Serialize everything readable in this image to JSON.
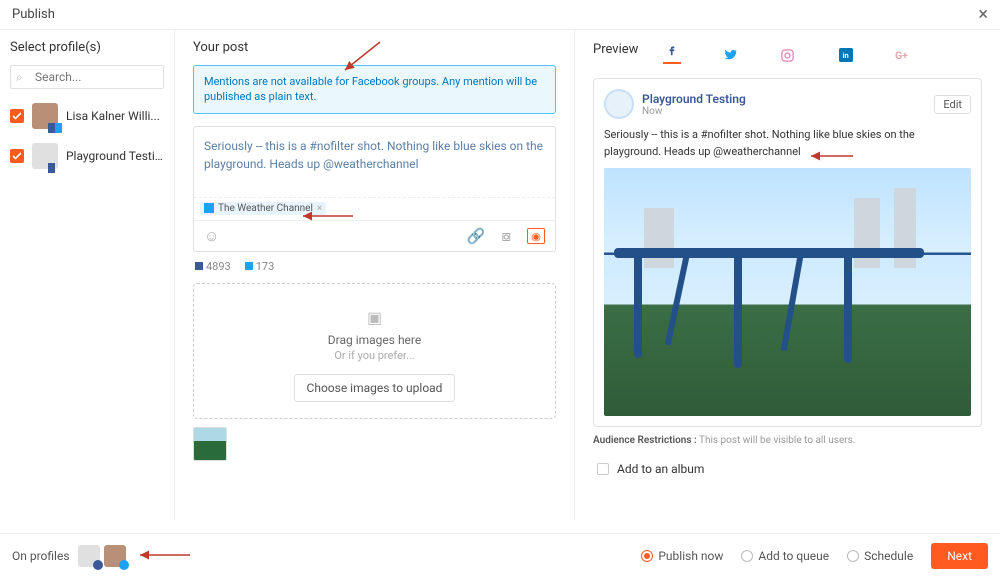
{
  "window": {
    "title": "Publish"
  },
  "left": {
    "heading": "Select profile(s)",
    "search_placeholder": "Search...",
    "profiles": [
      {
        "name": "Lisa Kalner Willi..."
      },
      {
        "name": "Playground Testi..."
      }
    ]
  },
  "mid": {
    "heading": "Your post",
    "alert": "Mentions are not available for Facebook groups. Any mention will be published as plain text.",
    "post_text": "Seriously -- this is a #nofilter shot. Nothing like blue skies on the playground. Heads up @weatherchannel",
    "tag_label": "The Weather Channel",
    "fb_count": "4893",
    "tw_count": "173",
    "drop_title": "Drag images here",
    "drop_sub": "Or if you prefer...",
    "choose_label": "Choose images to upload"
  },
  "right": {
    "heading": "Preview",
    "page_name": "Playground Testing",
    "page_time": "Now",
    "edit": "Edit",
    "text": "Seriously -- this is a #nofilter shot. Nothing like blue skies on the playground. Heads up @weatherchannel",
    "audience_label": "Audience Restrictions :",
    "audience_text": " This post will be visible to all users.",
    "album_label": "Add to an album"
  },
  "bottom": {
    "on_profiles": "On profiles",
    "publish_now": "Publish now",
    "add_queue": "Add to queue",
    "schedule": "Schedule",
    "next": "Next"
  }
}
